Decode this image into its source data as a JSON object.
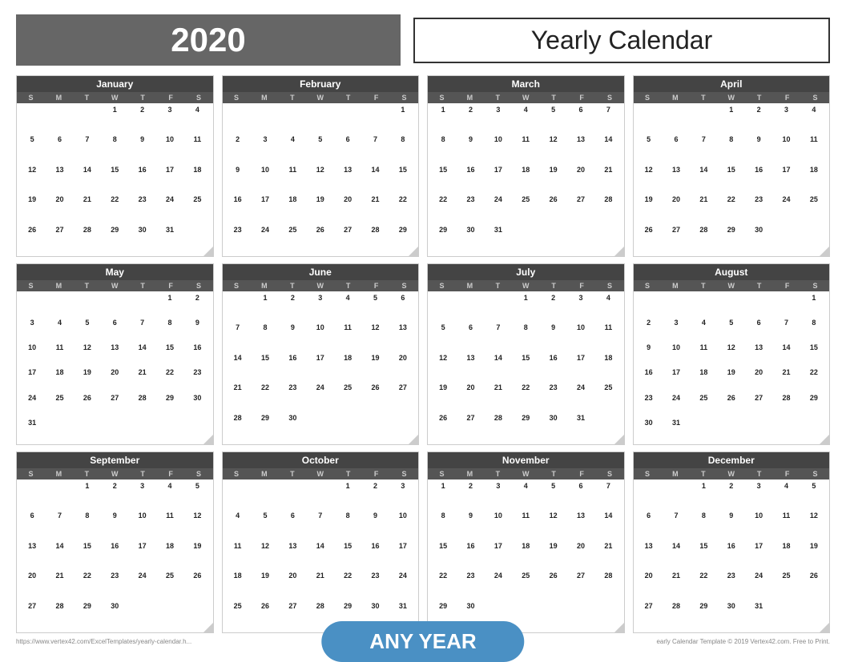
{
  "header": {
    "year": "2020",
    "title": "Yearly Calendar"
  },
  "footer": {
    "left_text": "https://www.vertex42.com/ExcelTemplates/yearly-calendar.h...",
    "right_text": "early Calendar Template © 2019 Vertex42.com. Free to Print.",
    "any_year_label": "ANY YEAR"
  },
  "months": [
    {
      "name": "January",
      "days_header": [
        "S",
        "M",
        "T",
        "W",
        "T",
        "F",
        "S"
      ],
      "weeks": [
        [
          "",
          "",
          "",
          "1",
          "2",
          "3",
          "4"
        ],
        [
          "5",
          "6",
          "7",
          "8",
          "9",
          "10",
          "11"
        ],
        [
          "12",
          "13",
          "14",
          "15",
          "16",
          "17",
          "18"
        ],
        [
          "19",
          "20",
          "21",
          "22",
          "23",
          "24",
          "25"
        ],
        [
          "26",
          "27",
          "28",
          "29",
          "30",
          "31",
          ""
        ]
      ]
    },
    {
      "name": "February",
      "days_header": [
        "S",
        "M",
        "T",
        "W",
        "T",
        "F",
        "S"
      ],
      "weeks": [
        [
          "",
          "",
          "",
          "",
          "",
          "",
          "1"
        ],
        [
          "2",
          "3",
          "4",
          "5",
          "6",
          "7",
          "8"
        ],
        [
          "9",
          "10",
          "11",
          "12",
          "13",
          "14",
          "15"
        ],
        [
          "16",
          "17",
          "18",
          "19",
          "20",
          "21",
          "22"
        ],
        [
          "23",
          "24",
          "25",
          "26",
          "27",
          "28",
          "29"
        ]
      ]
    },
    {
      "name": "March",
      "days_header": [
        "S",
        "M",
        "T",
        "W",
        "T",
        "F",
        "S"
      ],
      "weeks": [
        [
          "1",
          "2",
          "3",
          "4",
          "5",
          "6",
          "7"
        ],
        [
          "8",
          "9",
          "10",
          "11",
          "12",
          "13",
          "14"
        ],
        [
          "15",
          "16",
          "17",
          "18",
          "19",
          "20",
          "21"
        ],
        [
          "22",
          "23",
          "24",
          "25",
          "26",
          "27",
          "28"
        ],
        [
          "29",
          "30",
          "31",
          "",
          "",
          "",
          ""
        ]
      ]
    },
    {
      "name": "April",
      "days_header": [
        "S",
        "M",
        "T",
        "W",
        "T",
        "F",
        "S"
      ],
      "weeks": [
        [
          "",
          "",
          "",
          "1",
          "2",
          "3",
          "4"
        ],
        [
          "5",
          "6",
          "7",
          "8",
          "9",
          "10",
          "11"
        ],
        [
          "12",
          "13",
          "14",
          "15",
          "16",
          "17",
          "18"
        ],
        [
          "19",
          "20",
          "21",
          "22",
          "23",
          "24",
          "25"
        ],
        [
          "26",
          "27",
          "28",
          "29",
          "30",
          "",
          ""
        ]
      ]
    },
    {
      "name": "May",
      "days_header": [
        "S",
        "M",
        "T",
        "W",
        "T",
        "F",
        "S"
      ],
      "weeks": [
        [
          "",
          "",
          "",
          "",
          "",
          "1",
          "2"
        ],
        [
          "3",
          "4",
          "5",
          "6",
          "7",
          "8",
          "9"
        ],
        [
          "10",
          "11",
          "12",
          "13",
          "14",
          "15",
          "16"
        ],
        [
          "17",
          "18",
          "19",
          "20",
          "21",
          "22",
          "23"
        ],
        [
          "24",
          "25",
          "26",
          "27",
          "28",
          "29",
          "30"
        ],
        [
          "31",
          "",
          "",
          "",
          "",
          "",
          ""
        ]
      ]
    },
    {
      "name": "June",
      "days_header": [
        "S",
        "M",
        "T",
        "W",
        "T",
        "F",
        "S"
      ],
      "weeks": [
        [
          "",
          "1",
          "2",
          "3",
          "4",
          "5",
          "6"
        ],
        [
          "7",
          "8",
          "9",
          "10",
          "11",
          "12",
          "13"
        ],
        [
          "14",
          "15",
          "16",
          "17",
          "18",
          "19",
          "20"
        ],
        [
          "21",
          "22",
          "23",
          "24",
          "25",
          "26",
          "27"
        ],
        [
          "28",
          "29",
          "30",
          "",
          "",
          "",
          ""
        ]
      ]
    },
    {
      "name": "July",
      "days_header": [
        "S",
        "M",
        "T",
        "W",
        "T",
        "F",
        "S"
      ],
      "weeks": [
        [
          "",
          "",
          "",
          "1",
          "2",
          "3",
          "4"
        ],
        [
          "5",
          "6",
          "7",
          "8",
          "9",
          "10",
          "11"
        ],
        [
          "12",
          "13",
          "14",
          "15",
          "16",
          "17",
          "18"
        ],
        [
          "19",
          "20",
          "21",
          "22",
          "23",
          "24",
          "25"
        ],
        [
          "26",
          "27",
          "28",
          "29",
          "30",
          "31",
          ""
        ]
      ]
    },
    {
      "name": "August",
      "days_header": [
        "S",
        "M",
        "T",
        "W",
        "T",
        "F",
        "S"
      ],
      "weeks": [
        [
          "",
          "",
          "",
          "",
          "",
          "",
          "1"
        ],
        [
          "2",
          "3",
          "4",
          "5",
          "6",
          "7",
          "8"
        ],
        [
          "9",
          "10",
          "11",
          "12",
          "13",
          "14",
          "15"
        ],
        [
          "16",
          "17",
          "18",
          "19",
          "20",
          "21",
          "22"
        ],
        [
          "23",
          "24",
          "25",
          "26",
          "27",
          "28",
          "29"
        ],
        [
          "30",
          "31",
          "",
          "",
          "",
          "",
          ""
        ]
      ]
    },
    {
      "name": "September",
      "days_header": [
        "S",
        "M",
        "T",
        "W",
        "T",
        "F",
        "S"
      ],
      "weeks": [
        [
          "",
          "",
          "1",
          "2",
          "3",
          "4",
          "5"
        ],
        [
          "6",
          "7",
          "8",
          "9",
          "10",
          "11",
          "12"
        ],
        [
          "13",
          "14",
          "15",
          "16",
          "17",
          "18",
          "19"
        ],
        [
          "20",
          "21",
          "22",
          "23",
          "24",
          "25",
          "26"
        ],
        [
          "27",
          "28",
          "29",
          "30",
          "",
          "",
          ""
        ]
      ]
    },
    {
      "name": "October",
      "days_header": [
        "S",
        "M",
        "T",
        "W",
        "T",
        "F",
        "S"
      ],
      "weeks": [
        [
          "",
          "",
          "",
          "",
          "1",
          "2",
          "3"
        ],
        [
          "4",
          "5",
          "6",
          "7",
          "8",
          "9",
          "10"
        ],
        [
          "11",
          "12",
          "13",
          "14",
          "15",
          "16",
          "17"
        ],
        [
          "18",
          "19",
          "20",
          "21",
          "22",
          "23",
          "24"
        ],
        [
          "25",
          "26",
          "27",
          "28",
          "29",
          "30",
          "31"
        ]
      ]
    },
    {
      "name": "November",
      "days_header": [
        "S",
        "M",
        "T",
        "W",
        "T",
        "F",
        "S"
      ],
      "weeks": [
        [
          "1",
          "2",
          "3",
          "4",
          "5",
          "6",
          "7"
        ],
        [
          "8",
          "9",
          "10",
          "11",
          "12",
          "13",
          "14"
        ],
        [
          "15",
          "16",
          "17",
          "18",
          "19",
          "20",
          "21"
        ],
        [
          "22",
          "23",
          "24",
          "25",
          "26",
          "27",
          "28"
        ],
        [
          "29",
          "30",
          "",
          "",
          "",
          "",
          ""
        ]
      ]
    },
    {
      "name": "December",
      "days_header": [
        "S",
        "M",
        "T",
        "W",
        "T",
        "F",
        "S"
      ],
      "weeks": [
        [
          "",
          "",
          "1",
          "2",
          "3",
          "4",
          "5"
        ],
        [
          "6",
          "7",
          "8",
          "9",
          "10",
          "11",
          "12"
        ],
        [
          "13",
          "14",
          "15",
          "16",
          "17",
          "18",
          "19"
        ],
        [
          "20",
          "21",
          "22",
          "23",
          "24",
          "25",
          "26"
        ],
        [
          "27",
          "28",
          "29",
          "30",
          "31",
          "",
          ""
        ]
      ]
    }
  ]
}
